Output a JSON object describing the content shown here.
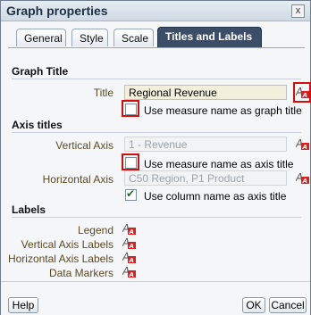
{
  "dialog": {
    "title": "Graph properties",
    "close_glyph": "x"
  },
  "tabs": [
    "General",
    "Style",
    "Scale",
    "Titles and Labels"
  ],
  "graph_title": {
    "section": "Graph Title",
    "title_label": "Title",
    "title_value": "Regional Revenue",
    "checkbox_label": "Use measure name as graph title"
  },
  "axis_titles": {
    "section": "Axis titles",
    "vertical_label": "Vertical Axis",
    "vertical_value": "1 - Revenue",
    "vertical_checkbox_label": "Use measure name as axis title",
    "horizontal_label": "Horizontal Axis",
    "horizontal_value": "C50  Region, P1  Product",
    "horizontal_checkbox_label": "Use column name as axis title"
  },
  "labels": {
    "section": "Labels",
    "items": [
      "Legend",
      "Vertical Axis Labels",
      "Horizontal Axis Labels",
      "Data Markers"
    ]
  },
  "buttons": {
    "help": "Help",
    "ok": "OK",
    "cancel": "Cancel"
  },
  "icons": {
    "format": "format-text-icon"
  },
  "colors": {
    "highlight": "#d20f0f",
    "active_tab": "#3c4e67",
    "field_bg": "#f2f0dc"
  }
}
